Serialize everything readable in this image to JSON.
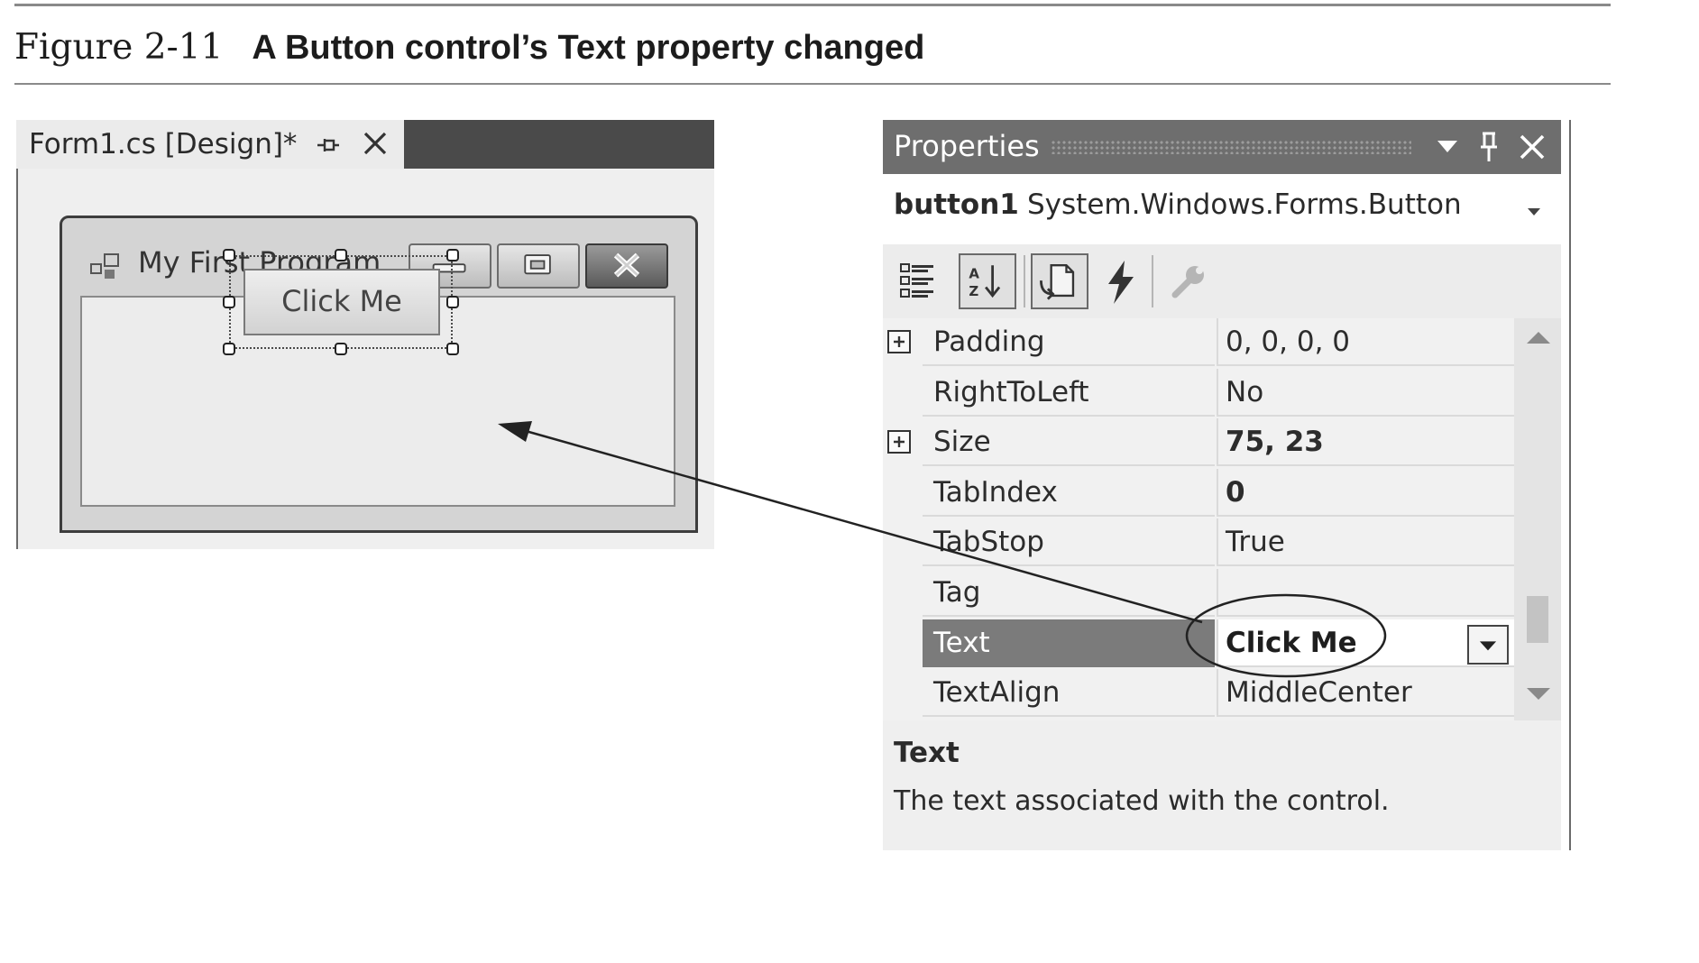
{
  "figure": {
    "number": "Figure 2-11",
    "title": "A Button control’s Text property changed"
  },
  "designer": {
    "tab_label": "Form1.cs [Design]*",
    "pin_icon": "pin-icon",
    "close_icon": "close-icon",
    "form": {
      "title": "My First Program",
      "app_icon": "form-app-icon",
      "caption_buttons": [
        "minimize-icon",
        "maximize-icon",
        "close-icon"
      ],
      "button_text": "Click Me"
    }
  },
  "properties": {
    "title": "Properties",
    "header_icons": [
      "dropdown-arrow-icon",
      "pin-icon",
      "close-icon"
    ],
    "object": {
      "name": "button1",
      "type": "System.Windows.Forms.Button"
    },
    "toolbar_icons": [
      "categorized-icon",
      "alphabetical-icon",
      "properties-icon",
      "events-icon",
      "property-pages-icon"
    ],
    "rows": [
      {
        "name": "Padding",
        "value": "0, 0, 0, 0",
        "expandable": true,
        "bold": false
      },
      {
        "name": "RightToLeft",
        "value": "No",
        "expandable": false,
        "bold": false
      },
      {
        "name": "Size",
        "value": "75, 23",
        "expandable": true,
        "bold": true
      },
      {
        "name": "TabIndex",
        "value": "0",
        "expandable": false,
        "bold": true
      },
      {
        "name": "TabStop",
        "value": "True",
        "expandable": false,
        "bold": false
      },
      {
        "name": "Tag",
        "value": "",
        "expandable": false,
        "bold": false
      },
      {
        "name": "Text",
        "value": "Click Me",
        "expandable": false,
        "bold": true,
        "selected": true
      },
      {
        "name": "TextAlign",
        "value": "MiddleCenter",
        "expandable": false,
        "bold": false
      }
    ],
    "description": {
      "title": "Text",
      "text": "The text associated with the control."
    }
  },
  "colors": {
    "panel_header": "#6e6e6e",
    "selected_row": "#7b7b7b",
    "designer_dark": "#4a4a4a"
  }
}
